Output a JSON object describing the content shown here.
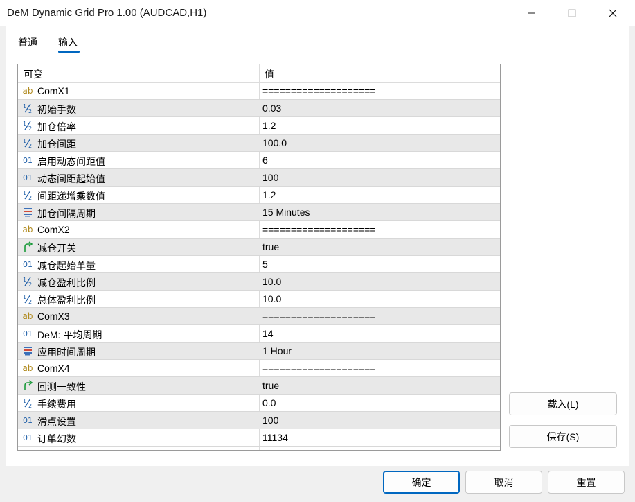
{
  "window": {
    "title": "DeM Dynamic Grid Pro 1.00 (AUDCAD,H1)"
  },
  "tabs": [
    {
      "label": "普通"
    },
    {
      "label": "输入"
    }
  ],
  "grid": {
    "header": {
      "name": "可变",
      "value": "值"
    },
    "rows": [
      {
        "icon": "ab-string-icon",
        "name": "ComX1",
        "value": "===================="
      },
      {
        "icon": "fraction-double-icon",
        "name": "初始手数",
        "value": "0.03"
      },
      {
        "icon": "fraction-double-icon",
        "name": "加仓倍率",
        "value": "1.2"
      },
      {
        "icon": "fraction-double-icon",
        "name": "加仓间距",
        "value": "100.0"
      },
      {
        "icon": "integer-01-icon",
        "name": "启用动态间距值",
        "value": "6"
      },
      {
        "icon": "integer-01-icon",
        "name": "动态间距起始值",
        "value": "100"
      },
      {
        "icon": "fraction-double-icon",
        "name": "间距递增乘数值",
        "value": "1.2"
      },
      {
        "icon": "enum-list-icon",
        "name": "加仓间隔周期",
        "value": "15 Minutes"
      },
      {
        "icon": "ab-string-icon",
        "name": "ComX2",
        "value": "===================="
      },
      {
        "icon": "bool-arrow-icon",
        "name": "减仓开关",
        "value": "true"
      },
      {
        "icon": "integer-01-icon",
        "name": "减仓起始单量",
        "value": "5"
      },
      {
        "icon": "fraction-double-icon",
        "name": "减仓盈利比例",
        "value": "10.0"
      },
      {
        "icon": "fraction-double-icon",
        "name": "总体盈利比例",
        "value": "10.0"
      },
      {
        "icon": "ab-string-icon",
        "name": "ComX3",
        "value": "===================="
      },
      {
        "icon": "integer-01-icon",
        "name": "DeM: 平均周期",
        "value": "14"
      },
      {
        "icon": "enum-list-icon",
        "name": "应用时间周期",
        "value": "1 Hour"
      },
      {
        "icon": "ab-string-icon",
        "name": "ComX4",
        "value": "===================="
      },
      {
        "icon": "bool-arrow-icon",
        "name": "回测一致性",
        "value": "true"
      },
      {
        "icon": "fraction-double-icon",
        "name": "手续费用",
        "value": "0.0"
      },
      {
        "icon": "integer-01-icon",
        "name": "滑点设置",
        "value": "100"
      },
      {
        "icon": "integer-01-icon",
        "name": "订单幻数",
        "value": "11134"
      }
    ]
  },
  "side_buttons": {
    "load_label": "载入(L)",
    "save_label": "保存(S)"
  },
  "footer": {
    "ok_label": "确定",
    "cancel_label": "取消",
    "reset_label": "重置"
  },
  "colors": {
    "accent": "#0067c0",
    "row_alt": "#e8e8e8",
    "string_icon": "#b08a1e",
    "int_icon": "#1f5fa8",
    "bool_icon": "#1a9a3a"
  }
}
